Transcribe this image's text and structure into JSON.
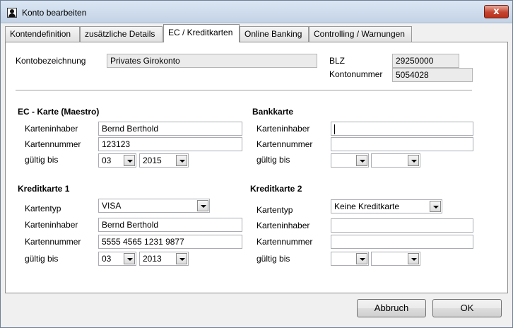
{
  "window": {
    "title": "Konto bearbeiten",
    "close_label": "x"
  },
  "tabs": [
    {
      "label": "Kontendefinition"
    },
    {
      "label": "zusätzliche Details"
    },
    {
      "label": "EC / Kreditkarten"
    },
    {
      "label": "Online Banking"
    },
    {
      "label": "Controlling / Warnungen"
    }
  ],
  "active_tab": 2,
  "account": {
    "name_label": "Kontobezeichnung",
    "name_value": "Privates Girokonto",
    "blz_label": "BLZ",
    "blz_value": "29250000",
    "number_label": "Kontonummer",
    "number_value": "5054028"
  },
  "ec_card": {
    "heading": "EC - Karte (Maestro)",
    "holder_label": "Karteninhaber",
    "holder_value": "Bernd Berthold",
    "number_label": "Kartennummer",
    "number_value": "123123",
    "valid_label": "gültig bis",
    "month": "03",
    "year": "2015"
  },
  "bank_card": {
    "heading": "Bankkarte",
    "holder_label": "Karteninhaber",
    "holder_value": "",
    "number_label": "Kartennummer",
    "number_value": "",
    "valid_label": "gültig bis",
    "month": "",
    "year": ""
  },
  "credit_card_1": {
    "heading": "Kreditkarte 1",
    "type_label": "Kartentyp",
    "type_value": "VISA",
    "holder_label": "Karteninhaber",
    "holder_value": "Bernd Berthold",
    "number_label": "Kartennummer",
    "number_value": "5555 4565 1231 9877",
    "valid_label": "gültig bis",
    "month": "03",
    "year": "2013"
  },
  "credit_card_2": {
    "heading": "Kreditkarte 2",
    "type_label": "Kartentyp",
    "type_value": "Keine Kreditkarte",
    "holder_label": "Karteninhaber",
    "holder_value": "",
    "number_label": "Kartennummer",
    "number_value": "",
    "valid_label": "gültig bis",
    "month": "",
    "year": ""
  },
  "buttons": {
    "cancel": "Abbruch",
    "ok": "OK"
  }
}
